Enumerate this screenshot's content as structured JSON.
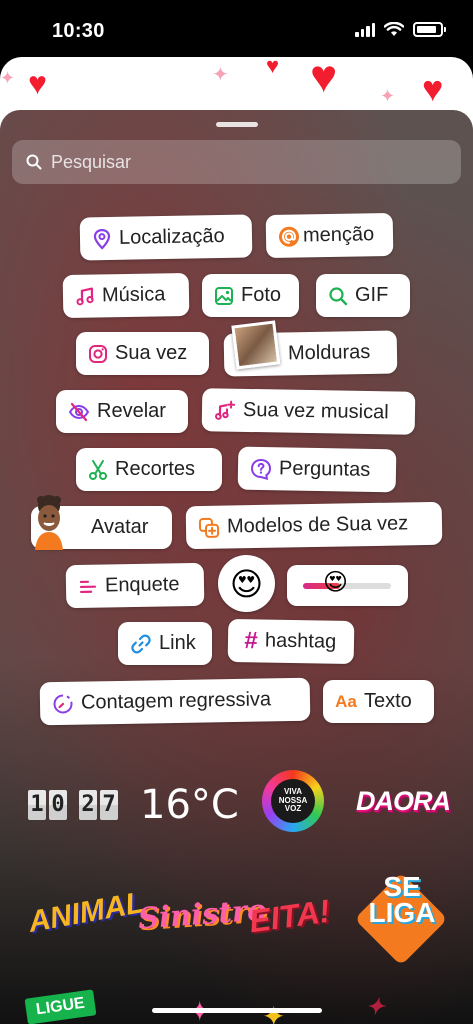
{
  "status_bar": {
    "time": "10:30"
  },
  "search": {
    "placeholder": "Pesquisar"
  },
  "stickers": {
    "location": "Localização",
    "mention": "menção",
    "music": "Música",
    "photo": "Foto",
    "gif": "GIF",
    "your_turn": "Sua vez",
    "frames": "Molduras",
    "reveal": "Revelar",
    "your_turn_music": "Sua vez musical",
    "cutouts": "Recortes",
    "questions": "Perguntas",
    "avatar": "Avatar",
    "your_turn_templates": "Modelos de Sua vez",
    "poll": "Enquete",
    "emoji_slider_emoji": "😍",
    "link": "Link",
    "hashtag": "hashtag",
    "countdown": "Contagem regressiva",
    "text": "Texto",
    "text_icon": "Aa"
  },
  "slider": {
    "fill": 0.42
  },
  "bottom_stickers": {
    "clock_digits": [
      "1",
      "0",
      "2",
      "7"
    ],
    "temperature": "16°C",
    "viva_lines": [
      "VIVA",
      "NOSSA",
      "VOZ"
    ],
    "daora": "DAORA",
    "animal": "ANIMAL",
    "sinistro": "Sinistro",
    "eita": "EITA!",
    "se_liga_line1": "SE",
    "se_liga_line2": "LIGA",
    "ligue": "LIGUE"
  },
  "colors": {
    "accent_magenta": "#c2188f",
    "accent_orange": "#f47a1f",
    "accent_green": "#1fb254",
    "accent_purple": "#8a3ee8",
    "accent_blue": "#1f8fe0",
    "accent_pink": "#e2257f"
  }
}
